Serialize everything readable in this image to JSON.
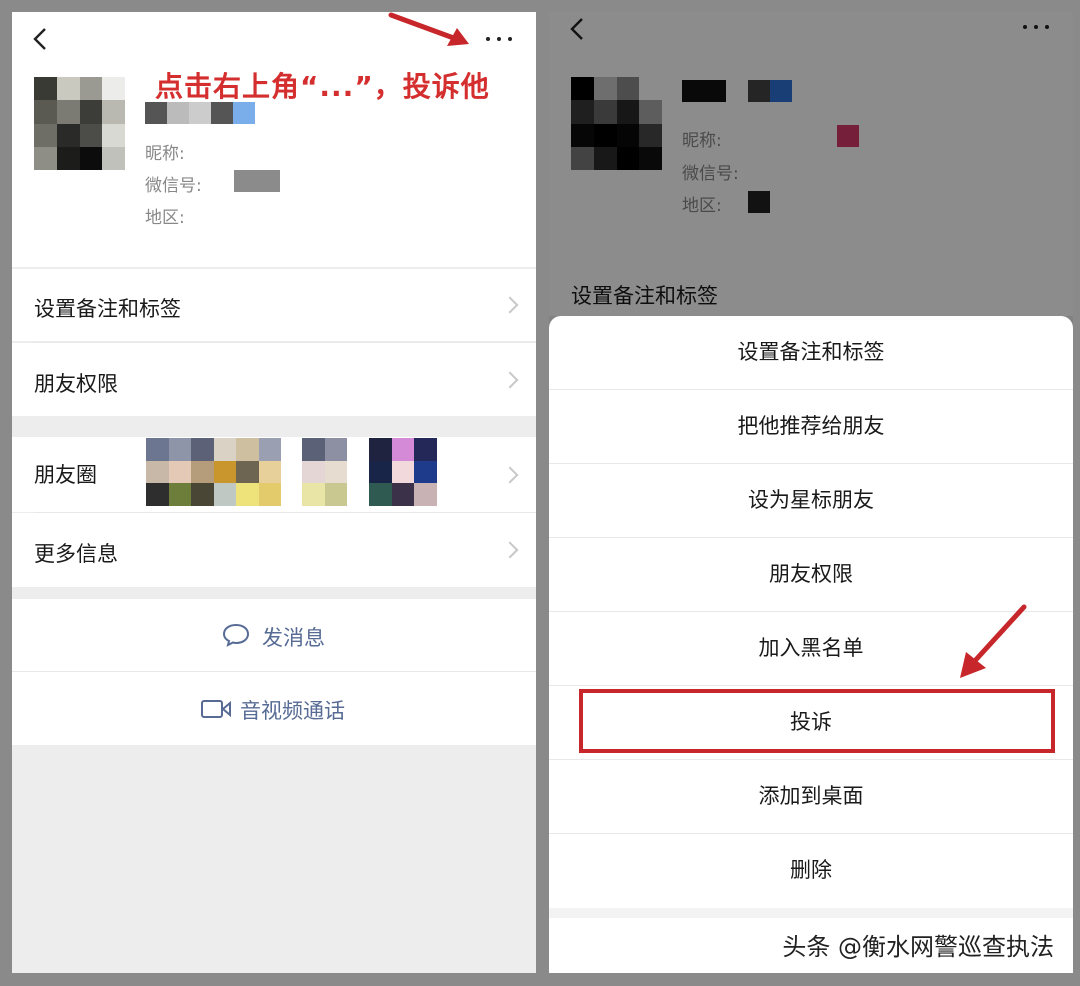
{
  "left": {
    "annotation": "点击右上角“...”，投诉他",
    "profile": {
      "nickname_label": "昵称:",
      "wechat_id_label": "微信号:",
      "region_label": "地区:"
    },
    "cells": [
      {
        "label": "设置备注和标签"
      },
      {
        "label": "朋友权限"
      }
    ],
    "moments_label": "朋友圈",
    "more_info_label": "更多信息",
    "send_message_label": "发消息",
    "video_call_label": "音视频通话"
  },
  "right": {
    "profile": {
      "nickname_label": "昵称:",
      "wechat_id_label": "微信号:",
      "region_label": "地区:"
    },
    "bg_cell_label": "设置备注和标签",
    "menu": [
      "设置备注和标签",
      "把他推荐给朋友",
      "设为星标朋友",
      "朋友权限",
      "加入黑名单",
      "投诉",
      "添加到桌面",
      "删除"
    ],
    "highlighted_item": "投诉"
  },
  "watermark": "头条 @衡水网警巡查执法",
  "colors": {
    "annotation_red": "#d42e2e",
    "link_blue": "#576b95",
    "highlight_red": "#c7262a"
  },
  "icons": [
    "back-chevron-icon",
    "more-dots-icon",
    "chat-bubble-icon",
    "video-camera-icon",
    "chevron-right-icon",
    "red-arrow-icon"
  ]
}
